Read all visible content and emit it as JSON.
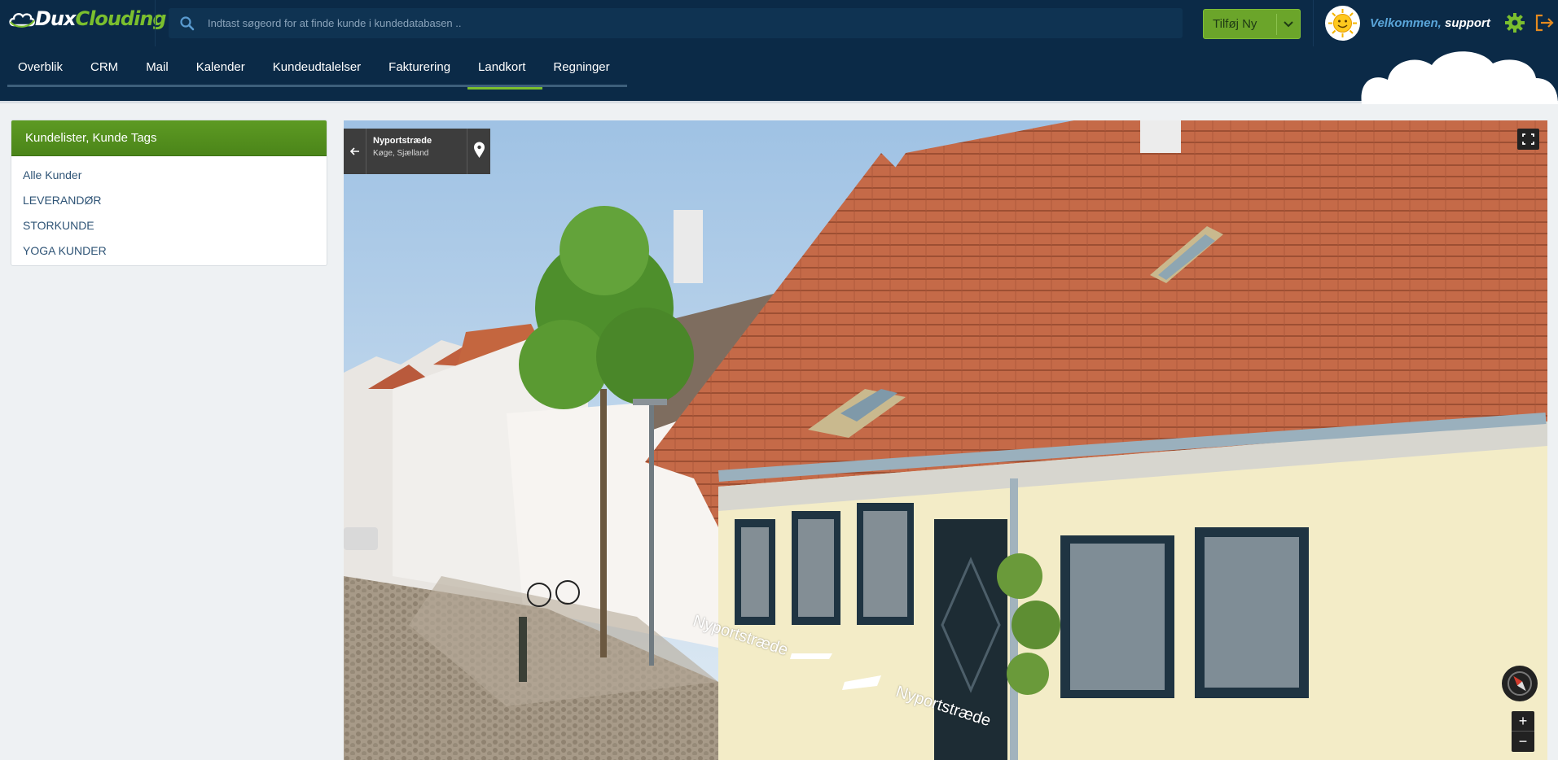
{
  "app": {
    "logo_text_1": "Dux",
    "logo_text_2": "Clouding",
    "search_placeholder": "Indtast søgeord for at finde kunde i kundedatabasen ..",
    "add_button_label": "Tilføj Ny",
    "welcome_prefix": "Velkommen,",
    "welcome_user": "support",
    "brand_green": "#6ba52a",
    "header_bg": "#0b2a47"
  },
  "nav": {
    "tabs": [
      {
        "label": "Overblik"
      },
      {
        "label": "CRM"
      },
      {
        "label": "Mail"
      },
      {
        "label": "Kalender"
      },
      {
        "label": "Kundeudtalelser"
      },
      {
        "label": "Fakturering"
      },
      {
        "label": "Landkort",
        "active": true
      },
      {
        "label": "Regninger"
      }
    ]
  },
  "sidebar": {
    "title": "Kundelister, Kunde Tags",
    "items": [
      {
        "label": "Alle Kunder"
      },
      {
        "label": "LEVERANDØR"
      },
      {
        "label": "STORKUNDE"
      },
      {
        "label": "YOGA KUNDER"
      }
    ]
  },
  "streetview": {
    "street": "Nyportstræde",
    "city": "Køge, Sjælland",
    "road_label_1": "Nyportstræde",
    "road_label_2": "Nyportstræde",
    "zoom_in": "+",
    "zoom_out": "−"
  }
}
